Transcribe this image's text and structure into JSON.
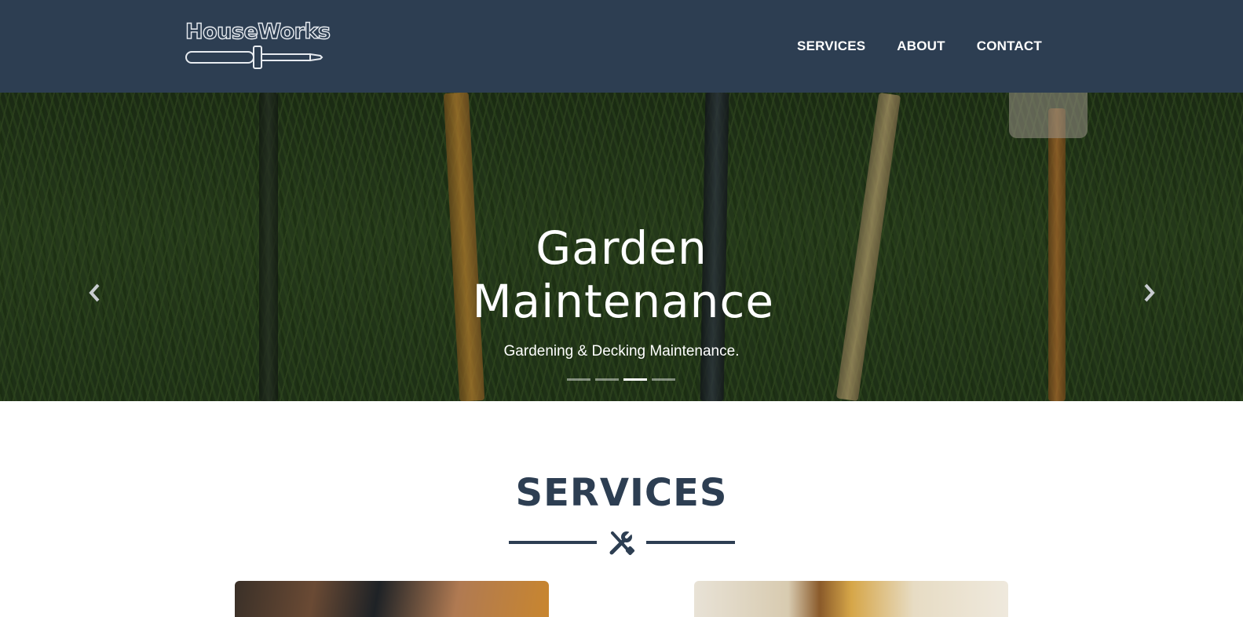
{
  "brand": {
    "name": "HouseWorks",
    "logo_icon": "screwdriver-icon"
  },
  "nav": {
    "items": [
      {
        "label": "SERVICES"
      },
      {
        "label": "ABOUT"
      },
      {
        "label": "CONTACT"
      }
    ]
  },
  "hero": {
    "title": "Garden Maintenance",
    "subtitle": "Gardening & Decking Maintenance.",
    "prev_icon": "chevron-left-icon",
    "next_icon": "chevron-right-icon",
    "slides_total": 4,
    "active_slide": 3
  },
  "services": {
    "heading": "SERVICES",
    "divider_icon": "tools-icon"
  },
  "colors": {
    "primary": "#2d3e52",
    "white": "#ffffff"
  }
}
